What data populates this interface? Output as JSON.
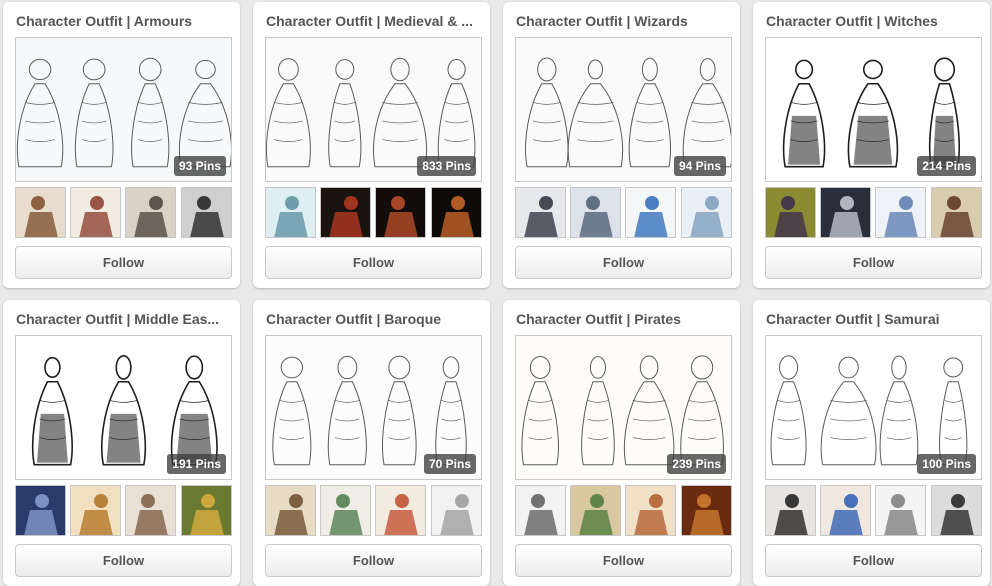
{
  "boards": [
    {
      "title": "Character Outfit | Armours",
      "pin_count": "93 Pins",
      "cover_icon": "armour-sketch-image",
      "cover_tint": "#f6f8fa",
      "thumbs": [
        {
          "icon": "warrior-thumbnail",
          "bg": "#e8ddcc",
          "fg": "#7a4a2a"
        },
        {
          "icon": "armour-sheet-thumbnail",
          "bg": "#f1ece2",
          "fg": "#8a3a2a"
        },
        {
          "icon": "armoured-creature-thumbnail",
          "bg": "#d9d3c7",
          "fg": "#4a4038"
        },
        {
          "icon": "dark-knight-thumbnail",
          "bg": "#cfcfcf",
          "fg": "#1e1e1e"
        }
      ],
      "follow_label": "Follow"
    },
    {
      "title": "Character Outfit | Medieval & ...",
      "pin_count": "833 Pins",
      "cover_icon": "medieval-sketch-image",
      "cover_tint": "#fafafa",
      "thumbs": [
        {
          "icon": "blue-sketch-thumbnail",
          "bg": "#dfeef2",
          "fg": "#5a8ea0"
        },
        {
          "icon": "red-jester-thumbnail",
          "bg": "#1a1410",
          "fg": "#b83a22"
        },
        {
          "icon": "red-noble-thumbnail",
          "bg": "#120c0a",
          "fg": "#c0502a"
        },
        {
          "icon": "orange-figure-thumbnail",
          "bg": "#0e0a08",
          "fg": "#d06a2a"
        }
      ],
      "follow_label": "Follow"
    },
    {
      "title": "Character Outfit | Wizards",
      "pin_count": "94 Pins",
      "cover_icon": "wizard-sketch-image",
      "cover_tint": "#fafafa",
      "thumbs": [
        {
          "icon": "dark-wizard-thumbnail",
          "bg": "#e6e8ec",
          "fg": "#2a2e3a"
        },
        {
          "icon": "grey-wizard-thumbnail",
          "bg": "#dde2ea",
          "fg": "#4a5a70"
        },
        {
          "icon": "blue-staff-thumbnail",
          "bg": "#f4f6f8",
          "fg": "#2a6ab8"
        },
        {
          "icon": "ice-wizard-thumbnail",
          "bg": "#e8f0f6",
          "fg": "#7a9ab8"
        }
      ],
      "follow_label": "Follow"
    },
    {
      "title": "Character Outfit | Witches",
      "pin_count": "214 Pins",
      "cover_icon": "witch-sketch-image",
      "cover_tint": "#ffffff",
      "thumbs": [
        {
          "icon": "green-witch-thumbnail",
          "bg": "#8a8a30",
          "fg": "#3a2a50"
        },
        {
          "icon": "shadow-witch-thumbnail",
          "bg": "#2a2e3a",
          "fg": "#c8ccd8"
        },
        {
          "icon": "pale-witch-thumbnail",
          "bg": "#eef2f6",
          "fg": "#5a7ab0"
        },
        {
          "icon": "broom-witch-thumbnail",
          "bg": "#d8cbb0",
          "fg": "#5a3020"
        }
      ],
      "follow_label": "Follow"
    },
    {
      "title": "Character Outfit | Middle Eas...",
      "pin_count": "191 Pins",
      "cover_icon": "middle-east-sketch-image",
      "cover_tint": "#ffffff",
      "thumbs": [
        {
          "icon": "blue-hooded-thumbnail",
          "bg": "#2a3a6a",
          "fg": "#8aa0d0"
        },
        {
          "icon": "golden-warrior-thumbnail",
          "bg": "#f0e0c0",
          "fg": "#b07020"
        },
        {
          "icon": "villagers-thumbnail",
          "bg": "#e8e0d4",
          "fg": "#7a5a40"
        },
        {
          "icon": "green-genie-thumbnail",
          "bg": "#6a7a30",
          "fg": "#e0b040"
        }
      ],
      "follow_label": "Follow"
    },
    {
      "title": "Character Outfit | Baroque",
      "pin_count": "70 Pins",
      "cover_icon": "baroque-sketch-image",
      "cover_tint": "#fcfcfc",
      "thumbs": [
        {
          "icon": "portrait-sketch-thumbnail",
          "bg": "#e8dcc4",
          "fg": "#6a4a2a"
        },
        {
          "icon": "colored-costumes-thumbnail",
          "bg": "#f0ece6",
          "fg": "#4a7a4a"
        },
        {
          "icon": "noble-figures-thumbnail",
          "bg": "#f2ece0",
          "fg": "#c04a2a"
        },
        {
          "icon": "gown-sketch-thumbnail",
          "bg": "#f2f2f2",
          "fg": "#9a9a9a"
        }
      ],
      "follow_label": "Follow"
    },
    {
      "title": "Character Outfit | Pirates",
      "pin_count": "239 Pins",
      "cover_icon": "pirate-sketch-image",
      "cover_tint": "#fdfcf8",
      "thumbs": [
        {
          "icon": "pirate-sketch-thumbnail",
          "bg": "#f2f2f2",
          "fg": "#5a5a5a"
        },
        {
          "icon": "green-pirate-thumbnail",
          "bg": "#d8c8a0",
          "fg": "#4a7a3a"
        },
        {
          "icon": "pirate-crew-thumbnail",
          "bg": "#f0e0c8",
          "fg": "#b05a2a"
        },
        {
          "icon": "bearded-pirate-thumbnail",
          "bg": "#6a2a10",
          "fg": "#d08030"
        }
      ],
      "follow_label": "Follow"
    },
    {
      "title": "Character Outfit | Samurai",
      "pin_count": "100 Pins",
      "cover_icon": "samurai-sketch-image",
      "cover_tint": "#ffffff",
      "thumbs": [
        {
          "icon": "red-samurai-thumbnail",
          "bg": "#e8e4e0",
          "fg": "#1a1a1a"
        },
        {
          "icon": "blue-samurai-thumbnail",
          "bg": "#f0e8e0",
          "fg": "#2a5ab0"
        },
        {
          "icon": "ink-samurai-thumbnail",
          "bg": "#f4f4f4",
          "fg": "#7a7a7a"
        },
        {
          "icon": "dark-ronin-thumbnail",
          "bg": "#dcdcdc",
          "fg": "#202020"
        }
      ],
      "follow_label": "Follow"
    }
  ]
}
